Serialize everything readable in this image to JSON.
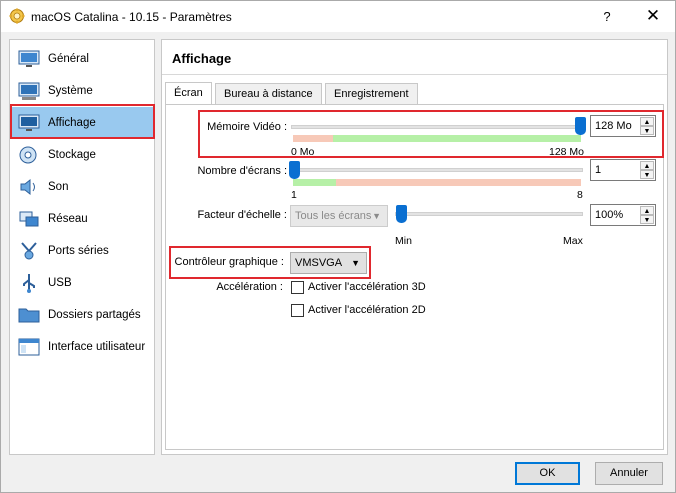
{
  "window": {
    "title": "macOS Catalina - 10.15 - Paramètres",
    "help_label": "?",
    "close_label": "✕"
  },
  "sidebar": {
    "items": [
      {
        "label": "Général",
        "icon": "general-icon"
      },
      {
        "label": "Système",
        "icon": "system-icon"
      },
      {
        "label": "Affichage",
        "icon": "display-icon"
      },
      {
        "label": "Stockage",
        "icon": "storage-icon"
      },
      {
        "label": "Son",
        "icon": "sound-icon"
      },
      {
        "label": "Réseau",
        "icon": "network-icon"
      },
      {
        "label": "Ports séries",
        "icon": "serial-ports-icon"
      },
      {
        "label": "USB",
        "icon": "usb-icon"
      },
      {
        "label": "Dossiers partagés",
        "icon": "shared-folders-icon"
      },
      {
        "label": "Interface utilisateur",
        "icon": "user-interface-icon"
      }
    ],
    "selected": "Affichage"
  },
  "page": {
    "title": "Affichage",
    "tabs": [
      "Écran",
      "Bureau à distance",
      "Enregistrement"
    ],
    "active_tab": "Écran"
  },
  "screen": {
    "video_memory": {
      "label": "Mémoire Vidéo :",
      "value": "128 Mo",
      "min_label": "0 Mo",
      "max_label": "128 Mo",
      "fraction": 1.0
    },
    "monitors": {
      "label": "Nombre d'écrans :",
      "value": "1",
      "min_label": "1",
      "max_label": "8",
      "fraction": 0.0
    },
    "scale": {
      "label": "Facteur d'échelle :",
      "combo_value": "Tous les écrans",
      "value": "100%",
      "min_label": "Min",
      "max_label": "Max",
      "fraction": 0.0
    },
    "controller": {
      "label": "Contrôleur graphique :",
      "value": "VMSVGA"
    },
    "acceleration": {
      "label": "Accélération :",
      "option_3d": "Activer l'accélération 3D",
      "option_2d": "Activer l'accélération 2D",
      "checked_3d": false,
      "checked_2d": false
    }
  },
  "buttons": {
    "ok": "OK",
    "cancel": "Annuler"
  },
  "colors": {
    "accent": "#0a6fd1",
    "selection": "#99c9ef",
    "highlight": "#e0282e",
    "range_good": "#b6f0a7",
    "range_bad": "#f7c9b8"
  }
}
